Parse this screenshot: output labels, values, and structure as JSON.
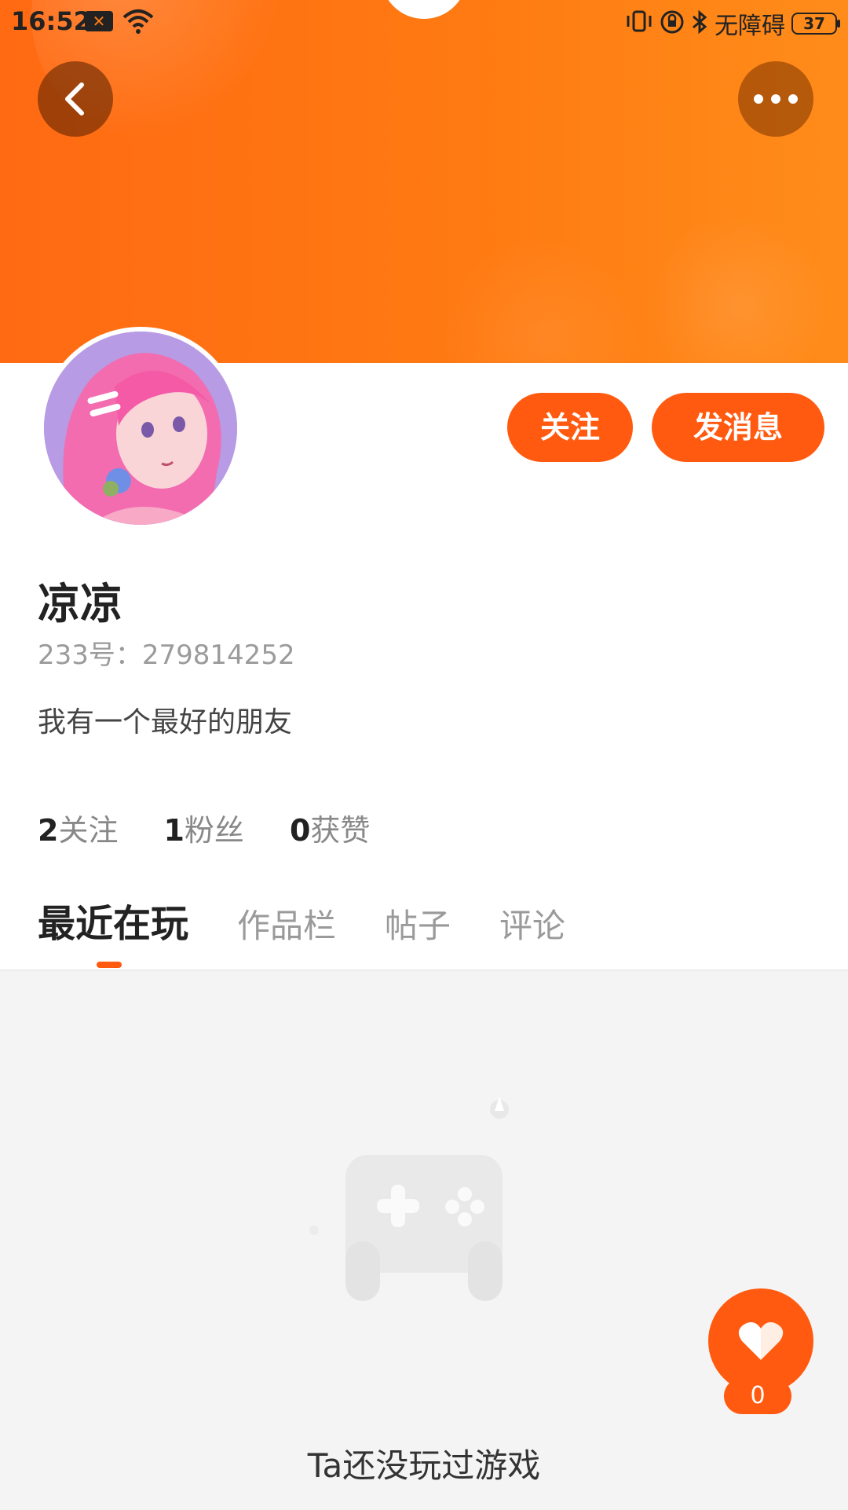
{
  "status_bar": {
    "time": "16:52",
    "accessibility_label": "无障碍",
    "battery": "37"
  },
  "profile": {
    "name": "凉凉",
    "id_text": "233号：279814252",
    "bio": "我有一个最好的朋友",
    "follow_button": "关注",
    "message_button": "发消息",
    "stats": [
      {
        "count": "2",
        "label": "关注"
      },
      {
        "count": "1",
        "label": "粉丝"
      },
      {
        "count": "0",
        "label": "获赞"
      }
    ]
  },
  "tabs": [
    {
      "label": "最近在玩",
      "active": true
    },
    {
      "label": "作品栏",
      "active": false
    },
    {
      "label": "帖子",
      "active": false
    },
    {
      "label": "评论",
      "active": false
    }
  ],
  "empty_state": {
    "message": "Ta还没玩过游戏"
  },
  "like": {
    "count": "0"
  },
  "colors": {
    "accent": "#ff5a0f",
    "banner_start": "#ff6a13",
    "banner_end": "#ff8c1a"
  }
}
